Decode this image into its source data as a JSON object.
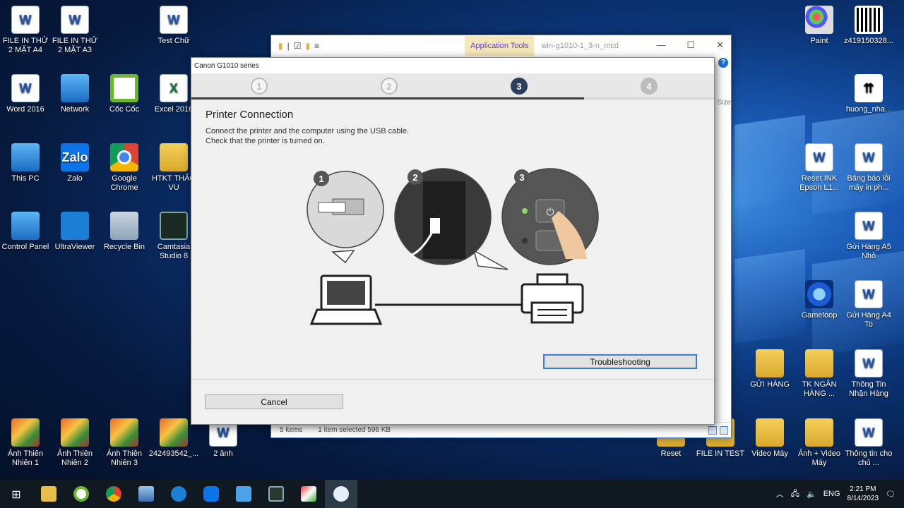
{
  "desktop": {
    "icons_left": [
      {
        "label": "FILE IN THỬ 2 MẶT A4",
        "type": "word"
      },
      {
        "label": "FILE IN THỬ 2 MẶT A3",
        "type": "word"
      },
      {
        "label": "Test Chữ",
        "type": "word"
      },
      {
        "label": "Word 2016",
        "type": "word"
      },
      {
        "label": "Network",
        "type": "pc"
      },
      {
        "label": "Cốc Cốc",
        "type": "coccoc"
      },
      {
        "label": "Excel 2016",
        "type": "excel"
      },
      {
        "label": "This PC",
        "type": "pc"
      },
      {
        "label": "Zalo",
        "type": "zalo"
      },
      {
        "label": "Google Chrome",
        "type": "chrome"
      },
      {
        "label": "HTKT THẢO VU",
        "type": "folder"
      },
      {
        "label": "Control Panel",
        "type": "pc"
      },
      {
        "label": "UltraViewer",
        "type": "blue"
      },
      {
        "label": "Recycle Bin",
        "type": "recycle"
      },
      {
        "label": "Camtasia Studio 8",
        "type": "dark"
      },
      {
        "label": "Ảnh Thiên Nhiên 1",
        "type": "photo"
      },
      {
        "label": "Ảnh Thiên Nhiên 2",
        "type": "photo"
      },
      {
        "label": "Ảnh Thiên Nhiên 3",
        "type": "photo"
      },
      {
        "label": "242493542_...",
        "type": "photo"
      },
      {
        "label": "2 ảnh",
        "type": "word"
      }
    ],
    "icons_right": [
      {
        "label": "Paint",
        "type": "paint"
      },
      {
        "label": "z419150328...",
        "type": "qr"
      },
      {
        "label": "huong_nha...",
        "type": "box"
      },
      {
        "label": "Reset INK Epson L1...",
        "type": "word"
      },
      {
        "label": "Bảng báo lỗi máy in ph...",
        "type": "word"
      },
      {
        "label": "Gửi Hàng A5 Nhỏ",
        "type": "word"
      },
      {
        "label": "Gameloop",
        "type": "game"
      },
      {
        "label": "Gửi Hàng A4 To",
        "type": "word"
      },
      {
        "label": "GỬI HÀNG",
        "type": "folder"
      },
      {
        "label": "TK NGÂN HÀNG ...",
        "type": "folder"
      },
      {
        "label": "Thông Tin Nhận Hàng",
        "type": "word"
      },
      {
        "label": "Reset",
        "type": "folder"
      },
      {
        "label": "FILE IN TEST",
        "type": "folder"
      },
      {
        "label": "Video Máy",
        "type": "folder"
      },
      {
        "label": "Ảnh + Video Máy",
        "type": "folder"
      },
      {
        "label": "Thông tin cho chủ ...",
        "type": "word"
      }
    ]
  },
  "explorer": {
    "app_tools_label": "Application Tools",
    "path_title": "win-g1010-1_3-n_mcd",
    "size_label": "Size",
    "status_items": "5 items",
    "status_selected": "1 item selected  596 KB"
  },
  "dialog": {
    "title": "Canon G1010 series",
    "steps": [
      "1",
      "2",
      "3",
      "4"
    ],
    "active_step": 3,
    "heading": "Printer Connection",
    "line1": "Connect the printer and the computer using the USB cable.",
    "line2": "Check that the printer is turned on.",
    "illustration_numbers": [
      "1",
      "2",
      "3"
    ],
    "troubleshooting_label": "Troubleshooting",
    "cancel_label": "Cancel"
  },
  "taskbar": {
    "language": "ENG",
    "time": "2:21 PM",
    "date": "8/14/2023"
  },
  "colors": {
    "active_step": "#2b3e5c",
    "focus_border": "#3b7fd0",
    "taskbar": "#101820"
  }
}
